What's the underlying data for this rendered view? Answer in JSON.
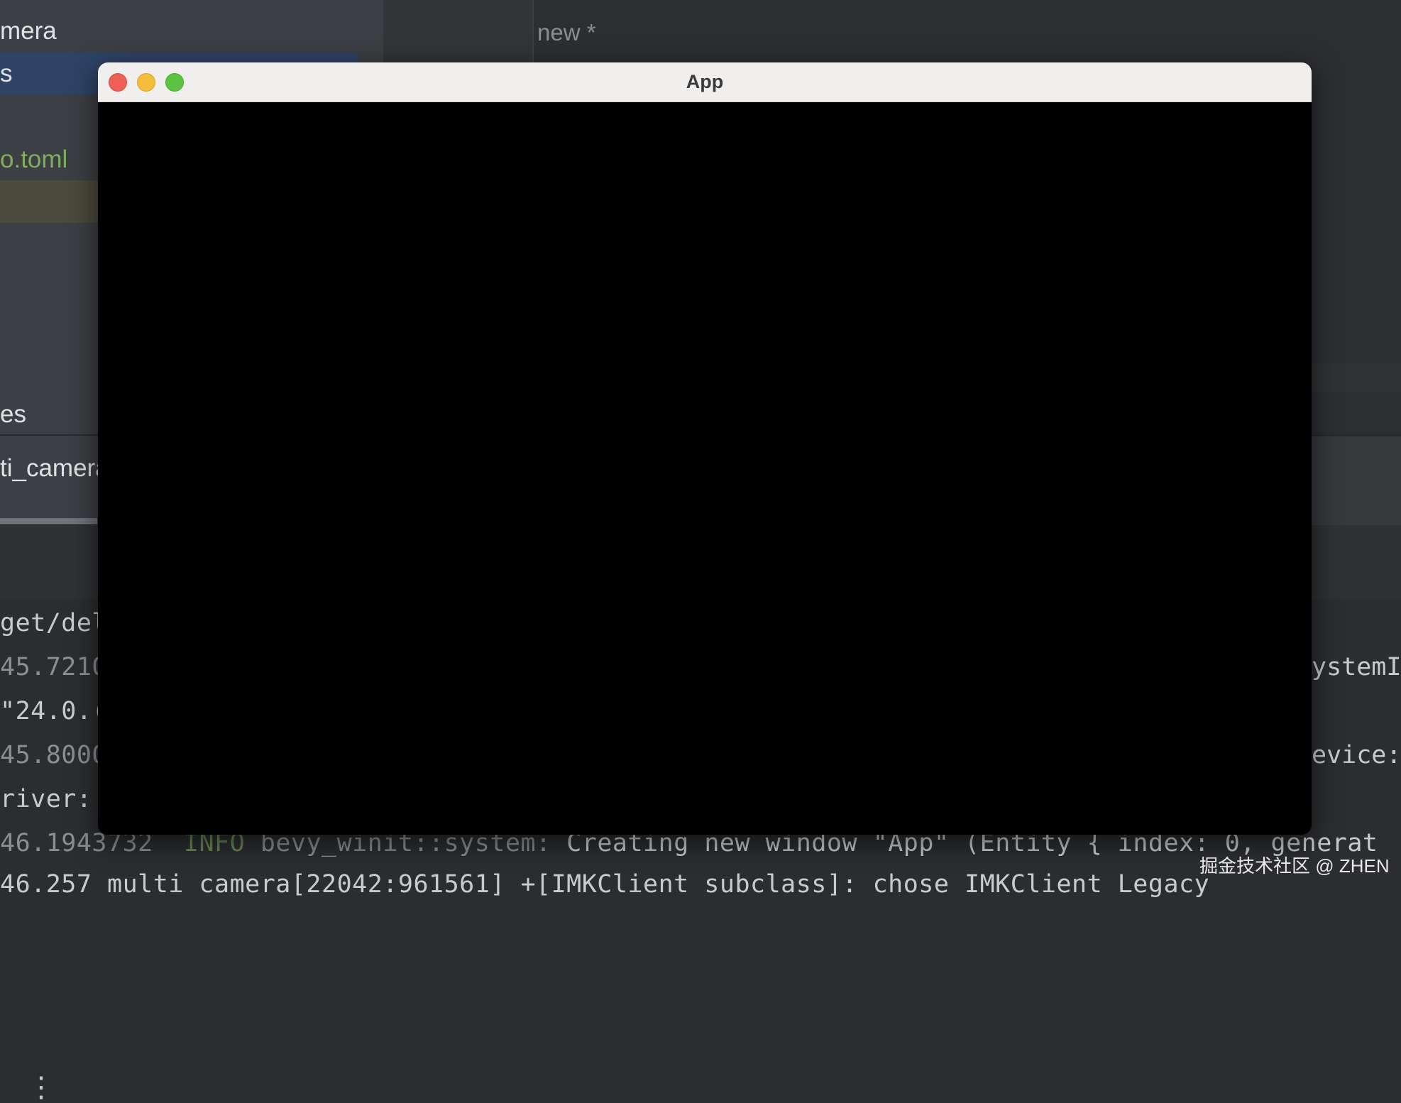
{
  "ide": {
    "project_tree": {
      "items": [
        {
          "label": "mera"
        },
        {
          "label": "s"
        },
        {
          "label": "o.toml"
        },
        {
          "label": "es"
        }
      ]
    },
    "editor": {
      "tab_label": "new *"
    },
    "run_panel": {
      "tab_label": "ti_camera",
      "more_icon": "more-vertical-icon"
    },
    "console": {
      "lines": [
        "get/del",
        "45.7210",
        "\"24.0.(",
        "45.8000",
        "river:",
        "46.257 multi camera[22042:961561] +[IMKClient subclass]: chose IMKClient Legacy"
      ],
      "info_line": {
        "timestamp": "46.1943732",
        "level": "INFO",
        "source": "bevy_winit::system:",
        "message": "Creating new window \"App\" (Entity { index: 0, generat"
      },
      "right_fragments": [
        "ystemI",
        "evice:"
      ]
    }
  },
  "app_window": {
    "title": "App",
    "buttons": {
      "close_icon": "close-icon",
      "minimize_icon": "minimize-icon",
      "zoom_icon": "zoom-icon"
    },
    "colors": {
      "close": "#ee5f57",
      "minimize": "#f6bd3b",
      "zoom": "#5bc341",
      "canvas": "#000000"
    }
  },
  "watermark": "掘金技术社区 @ ZHEN"
}
